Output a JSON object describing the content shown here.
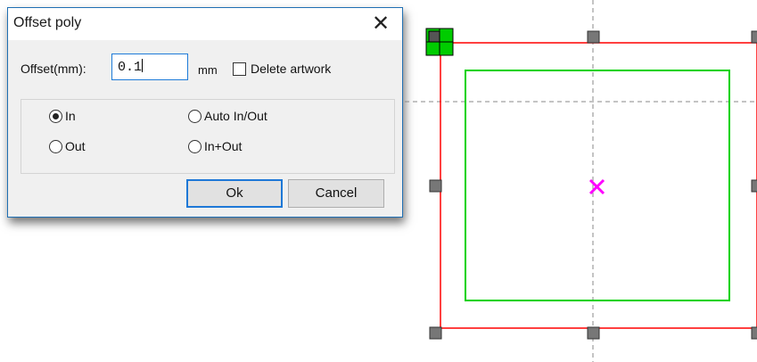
{
  "dialog": {
    "title": "Offset poly",
    "close_glyph": "✕",
    "offset_label": "Offset(mm):",
    "offset_value": "0.1",
    "unit": "mm",
    "delete_artwork_label": "Delete artwork",
    "delete_artwork_checked": false,
    "options": [
      {
        "label": "In",
        "selected": true
      },
      {
        "label": "Out",
        "selected": false
      },
      {
        "label": "Auto In/Out",
        "selected": false
      },
      {
        "label": "In+Out",
        "selected": false
      }
    ],
    "ok_label": "Ok",
    "cancel_label": "Cancel"
  },
  "canvas": {
    "colors": {
      "selection_frame": "#ff0000",
      "offset_path": "#00d200",
      "center_mark": "#ff00ff",
      "handle": "#777777",
      "active_handle": "#00cc00",
      "guide": "#888888"
    },
    "center_mark_icon": "x-mark-icon"
  }
}
